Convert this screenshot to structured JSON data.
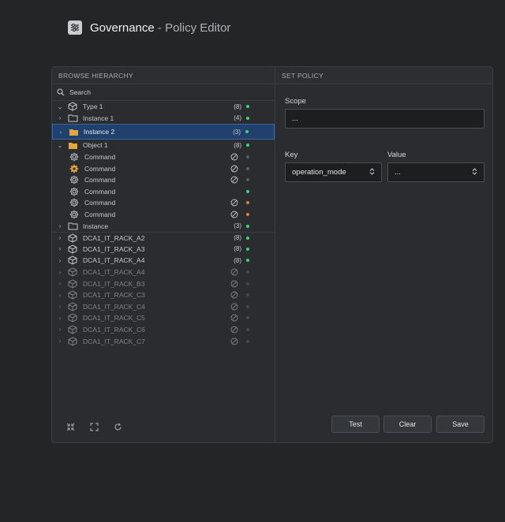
{
  "header": {
    "title": "Governance",
    "separator": " - ",
    "subtitle": "Policy Editor",
    "logo_icon": "sliders-icon"
  },
  "left": {
    "header": "BROWSE HIERARCHY",
    "search_label": "Search",
    "tree": [
      {
        "label": "Type 1",
        "chevron": "down",
        "icon": "cube",
        "count": "(8)",
        "dot": "#3fd07a"
      },
      {
        "label": "Instance 1",
        "chevron": "right",
        "icon": "folder-outline",
        "count": "(4)",
        "dot": "#3fd07a"
      },
      {
        "label": "Instance 2",
        "chevron": "right",
        "icon": "folder-filled",
        "count": "(3)",
        "dot": "#3fd07a",
        "selected": true
      },
      {
        "label": "Object 1",
        "chevron": "down",
        "icon": "folder-filled",
        "count": "(8)",
        "dot": "#3fd07a"
      },
      {
        "label": "Command",
        "chevron": "",
        "icon": "gear-outline",
        "count": "",
        "noentry": true,
        "dot": "#5a5e63",
        "indent": true
      },
      {
        "label": "Command",
        "chevron": "",
        "icon": "gear-filled",
        "count": "",
        "noentry": true,
        "dot": "#5a5e63",
        "indent": true
      },
      {
        "label": "Command",
        "chevron": "",
        "icon": "gear-outline",
        "count": "",
        "noentry": true,
        "dot": "#5a5e63",
        "indent": true
      },
      {
        "label": "Command",
        "chevron": "",
        "icon": "gear-outline",
        "count": "",
        "noentry": false,
        "dot": "#3fd07a",
        "indent": true
      },
      {
        "label": "Command",
        "chevron": "",
        "icon": "gear-outline",
        "count": "",
        "noentry": true,
        "dot": "#e07a3a",
        "indent": true
      },
      {
        "label": "Command",
        "chevron": "",
        "icon": "gear-outline",
        "count": "",
        "noentry": true,
        "dot": "#e07a3a",
        "indent": true
      },
      {
        "label": "Instance",
        "chevron": "right",
        "icon": "folder-outline",
        "count": "(3)",
        "dot": "#3fd07a"
      },
      {
        "label": "DCA1_IT_RACK_A2",
        "chevron": "right",
        "icon": "cube",
        "count": "(8)",
        "dot": "#3fd07a",
        "septop": true
      },
      {
        "label": "DCA1_IT_RACK_A3",
        "chevron": "right",
        "icon": "cube",
        "count": "(8)",
        "dot": "#3fd07a"
      },
      {
        "label": "DCA1_IT_RACK_A4",
        "chevron": "right",
        "icon": "cube",
        "count": "(8)",
        "dot": "#3fd07a"
      },
      {
        "label": "DCA1_IT_RACK_A4",
        "chevron": "right",
        "icon": "cube",
        "count": "",
        "noentry": true,
        "dot": "#5a5e63",
        "dim": true
      },
      {
        "label": "DCA1_IT_RACK_B3",
        "chevron": "right",
        "icon": "cube",
        "count": "",
        "noentry": true,
        "dot": "#5a5e63",
        "dim": true
      },
      {
        "label": "DCA1_IT_RACK_C3",
        "chevron": "right",
        "icon": "cube",
        "count": "",
        "noentry": true,
        "dot": "#5a5e63",
        "dim": true
      },
      {
        "label": "DCA1_IT_RACK_C4",
        "chevron": "right",
        "icon": "cube",
        "count": "",
        "noentry": true,
        "dot": "#5a5e63",
        "dim": true
      },
      {
        "label": "DCA1_IT_RACK_C5",
        "chevron": "right",
        "icon": "cube",
        "count": "",
        "noentry": true,
        "dot": "#5a5e63",
        "dim": true
      },
      {
        "label": "DCA1_IT_RACK_C6",
        "chevron": "right",
        "icon": "cube",
        "count": "",
        "noentry": true,
        "dot": "#5a5e63",
        "dim": true
      },
      {
        "label": "DCA1_IT_RACK_C7",
        "chevron": "right",
        "icon": "cube",
        "count": "",
        "noentry": true,
        "dot": "#5a5e63",
        "dim": true
      }
    ],
    "tools": [
      "collapse-icon",
      "expand-icon",
      "refresh-icon"
    ]
  },
  "right": {
    "header": "SET POLICY",
    "scope_label": "Scope",
    "scope_value": "...",
    "key_label": "Key",
    "key_value": "operation_mode",
    "value_label": "Value",
    "value_value": "...",
    "buttons": {
      "test": "Test",
      "clear": "Clear",
      "save": "Save"
    }
  }
}
